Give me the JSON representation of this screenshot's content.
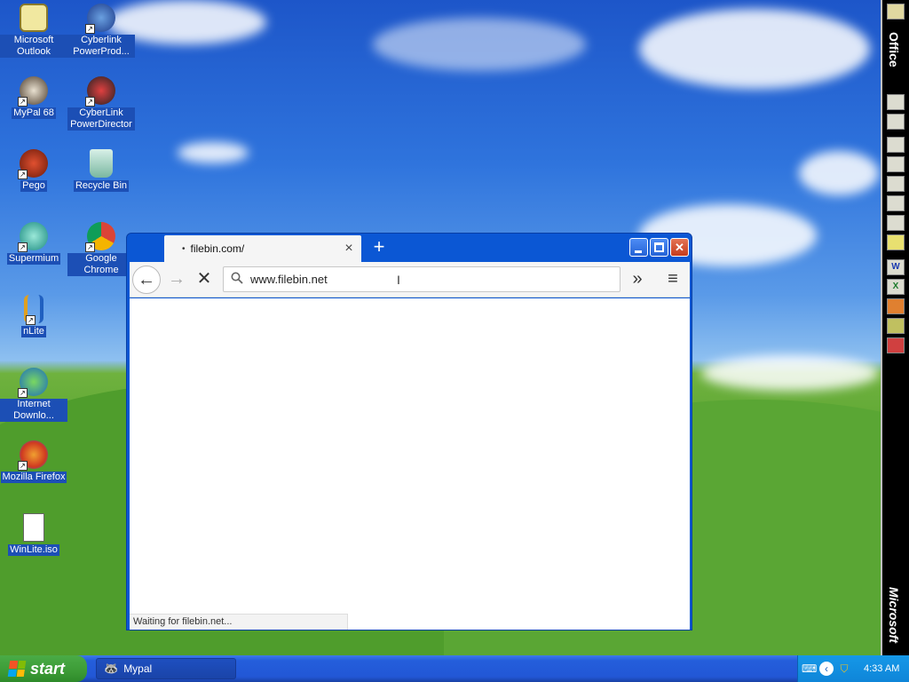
{
  "desktop_icons": [
    {
      "label": "Microsoft Outlook",
      "icon": "outlook-icon",
      "shortcut": false
    },
    {
      "label": "Cyberlink PowerProd...",
      "icon": "cyberlink-powerproducer-icon",
      "shortcut": true
    },
    {
      "label": "MyPal 68",
      "icon": "mypal-icon",
      "shortcut": true
    },
    {
      "label": "CyberLink PowerDirector",
      "icon": "cyberlink-powerdirector-icon",
      "shortcut": true
    },
    {
      "label": "Pego",
      "icon": "pego-icon",
      "shortcut": true
    },
    {
      "label": "Recycle Bin",
      "icon": "recycle-bin-icon",
      "shortcut": false
    },
    {
      "label": "Supermium",
      "icon": "supermium-icon",
      "shortcut": true
    },
    {
      "label": "Google Chrome",
      "icon": "chrome-icon",
      "shortcut": true
    },
    {
      "label": "nLite",
      "icon": "nlite-icon",
      "shortcut": true
    },
    {
      "label": "Internet Downlo...",
      "icon": "internet-download-manager-icon",
      "shortcut": true
    },
    {
      "label": "Mozilla Firefox",
      "icon": "firefox-icon",
      "shortcut": true
    },
    {
      "label": "WinLite.iso",
      "icon": "iso-file-icon",
      "shortcut": false
    }
  ],
  "office_bar": {
    "title": "Office",
    "brand": "Microsoft",
    "buttons": [
      "",
      "",
      "",
      "",
      "",
      "",
      "",
      "",
      "W",
      "X",
      "",
      "",
      ""
    ]
  },
  "browser": {
    "tab_title": "filebin.com/",
    "tab_dot": "•",
    "tab_close": "×",
    "new_tab": "+",
    "url": "www.filebin.net",
    "status": "Waiting for filebin.net...",
    "nav": {
      "back": "←",
      "forward": "→",
      "stop": "✕",
      "more": "»",
      "menu": "≡"
    },
    "window_buttons": {
      "minimize": "_",
      "maximize": "□",
      "close": "✕"
    }
  },
  "taskbar": {
    "start_label": "start",
    "task_label": "Mypal",
    "clock": "4:33 AM"
  },
  "colors": {
    "taskbar_blue": "#245edb",
    "start_green": "#3c9b36",
    "tray_blue": "#0f85d8",
    "window_blue": "#0b57d4"
  }
}
